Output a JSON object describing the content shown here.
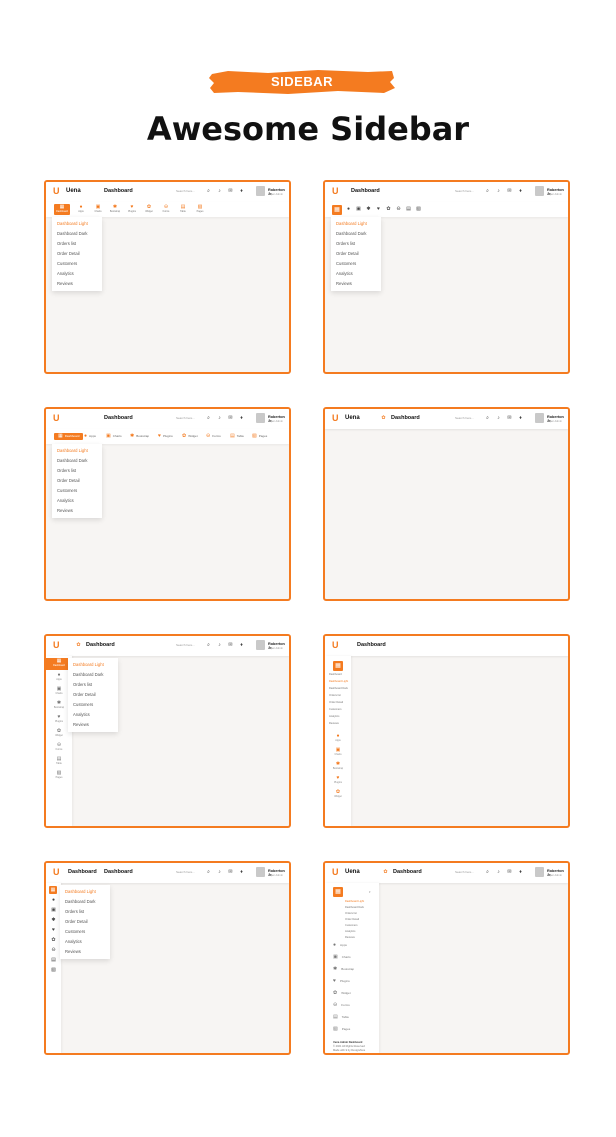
{
  "header": {
    "badge": "SIDEBAR",
    "title": "Awesome Sidebar"
  },
  "colors": {
    "accent": "#f47b20",
    "panel_bg": "#f7f5f3"
  },
  "common": {
    "brand": "Uena",
    "page_title": "Dashboard",
    "search_placeholder": "Search here...",
    "user_name": "Roberton Jr.",
    "user_role": "Super Admin"
  },
  "nav_labels": [
    "Dashboard",
    "Apps",
    "Charts",
    "Bootstrap",
    "Plugins",
    "Widget",
    "Forms",
    "Table",
    "Pages"
  ],
  "nav_icons": [
    "grid-icon",
    "info-icon",
    "chart-icon",
    "star-icon",
    "heart-icon",
    "settings-icon",
    "forms-icon",
    "table-icon",
    "pages-icon"
  ],
  "submenu": [
    "Dashboard Light",
    "Dashboard Dark",
    "Orders list",
    "Order Detail",
    "Customers",
    "Analytics",
    "Reviews"
  ],
  "footer": {
    "title": "Uena Admin Dashboard",
    "copyright": "© 2021 All Rights Reserved",
    "made_with": "Made with ♥ by DexignZone"
  }
}
